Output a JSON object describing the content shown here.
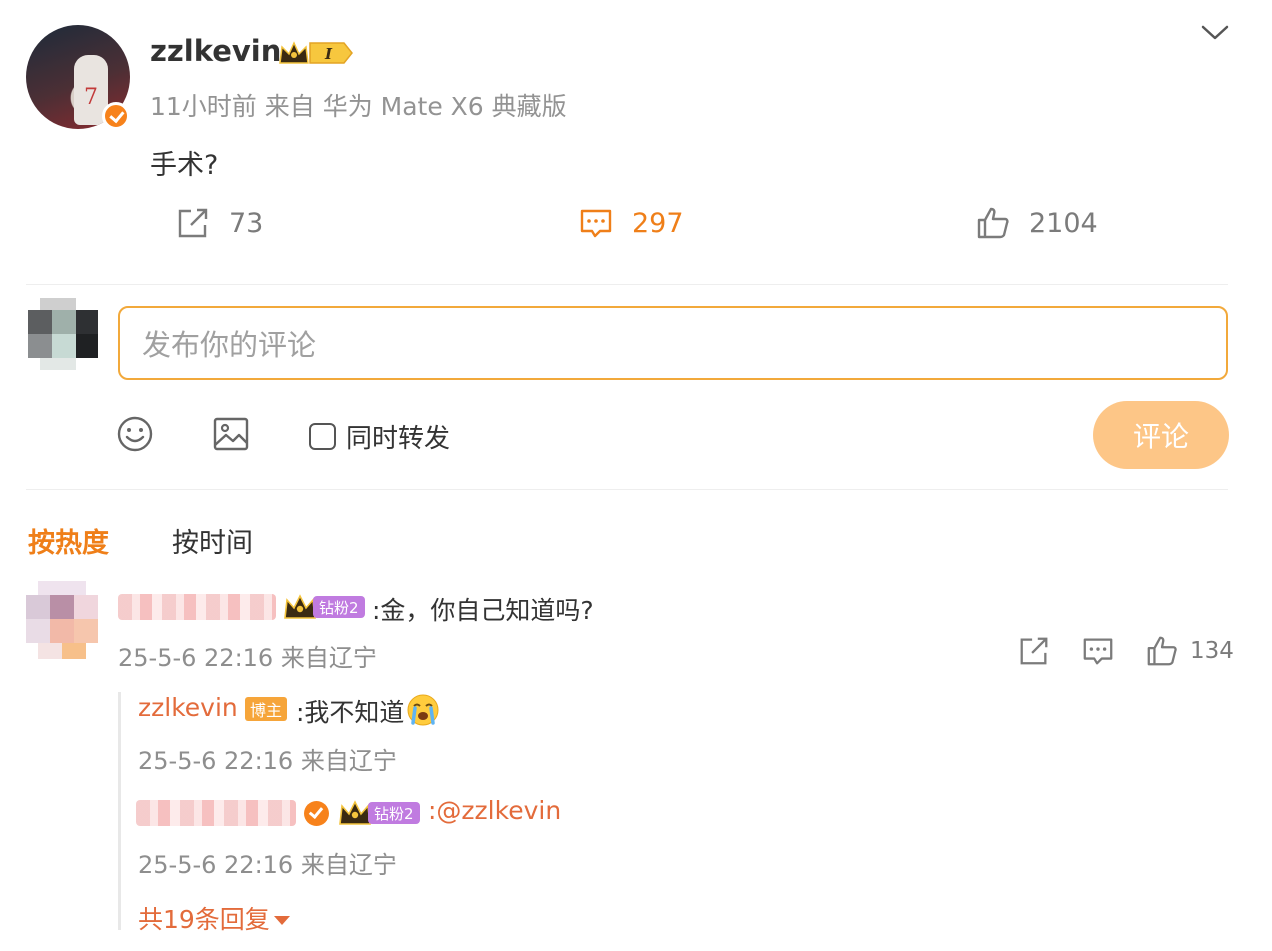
{
  "post": {
    "author": "zzlkevin",
    "meta": "11小时前 来自 华为 Mate X6 典藏版",
    "level_badge": "I",
    "text": "手术?",
    "repost_count": "73",
    "comment_count": "297",
    "like_count": "2104"
  },
  "composer": {
    "placeholder": "发布你的评论",
    "repost_label": "同时转发",
    "submit_label": "评论"
  },
  "sort": {
    "hot": "按热度",
    "time": "按时间"
  },
  "comment": {
    "fan_badge": "钻粉2",
    "text": ":金，你自己知道吗?",
    "meta": "25-5-6 22:16 来自辽宁",
    "like_count": "134"
  },
  "replies": [
    {
      "author": "zzlkevin",
      "badge": "博主",
      "text": ":我不知道",
      "meta": "25-5-6 22:16 来自辽宁"
    },
    {
      "fan_badge": "钻粉2",
      "text": ":@zzlkevin",
      "meta": "25-5-6 22:16 来自辽宁"
    }
  ],
  "more_replies": "共19条回复",
  "colors": {
    "accent": "#ef7f19",
    "link": "#e36b3b",
    "submit_disabled": "#fdc687",
    "input_border": "#f2a93b"
  },
  "icons": [
    "expand-chevron-icon",
    "repost-icon",
    "comment-icon",
    "like-icon",
    "emoji-icon",
    "image-icon",
    "crown-icon",
    "cry-emoji-icon",
    "caret-down-icon"
  ]
}
